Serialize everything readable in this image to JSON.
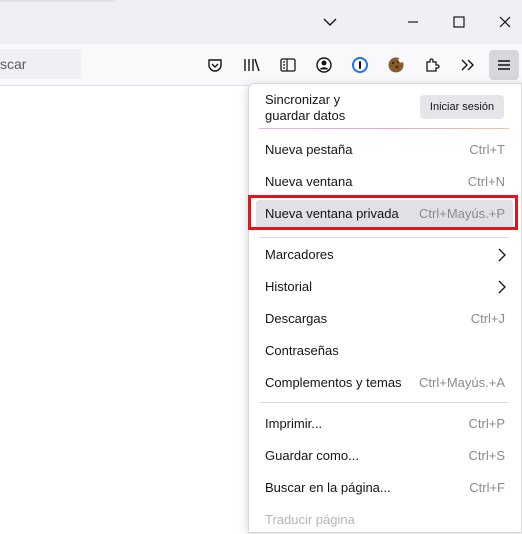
{
  "colors": {
    "accent_box": "#e0161e",
    "menu_hover": "#e0e0e6"
  },
  "urlbar": {
    "placeholder_fragment": "scar"
  },
  "toolbar": {
    "icons": [
      "pocket-icon",
      "library-icon",
      "sidebar-icon",
      "account-icon",
      "password-manager-icon",
      "cookie-extension-icon",
      "extensions-icon",
      "overflow-chevron-icon",
      "hamburger-menu-icon"
    ]
  },
  "menu": {
    "sync": {
      "label": "Sincronizar y guardar datos",
      "button": "Iniciar sesión"
    },
    "items": [
      {
        "label": "Nueva pestaña",
        "shortcut": "Ctrl+T"
      },
      {
        "label": "Nueva ventana",
        "shortcut": "Ctrl+N"
      },
      {
        "label": "Nueva ventana privada",
        "shortcut": "Ctrl+Mayús.+P"
      },
      {
        "label": "Marcadores",
        "shortcut": ""
      },
      {
        "label": "Historial",
        "shortcut": ""
      },
      {
        "label": "Descargas",
        "shortcut": "Ctrl+J"
      },
      {
        "label": "Contraseñas",
        "shortcut": ""
      },
      {
        "label": "Complementos y temas",
        "shortcut": "Ctrl+Mayús.+A"
      },
      {
        "label": "Imprimir...",
        "shortcut": "Ctrl+P"
      },
      {
        "label": "Guardar como...",
        "shortcut": "Ctrl+S"
      },
      {
        "label": "Buscar en la página...",
        "shortcut": "Ctrl+F"
      },
      {
        "label": "Traducir página",
        "shortcut": ""
      }
    ]
  }
}
